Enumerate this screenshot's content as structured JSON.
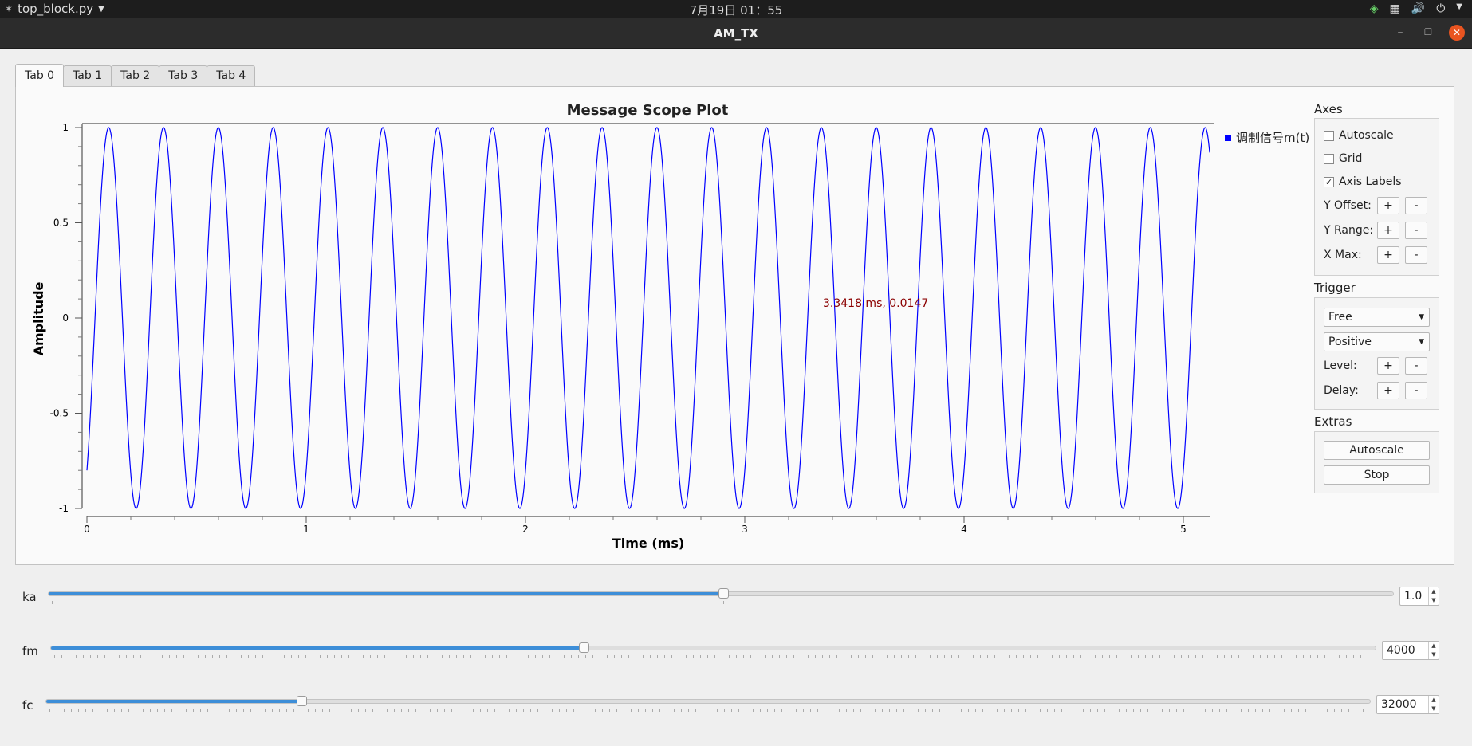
{
  "topbar": {
    "app_name": "top_block.py",
    "clock": "7月19日  01：55"
  },
  "window": {
    "title": "AM_TX"
  },
  "tabs": [
    {
      "label": "Tab 0",
      "active": true
    },
    {
      "label": "Tab 1",
      "active": false
    },
    {
      "label": "Tab 2",
      "active": false
    },
    {
      "label": "Tab 3",
      "active": false
    },
    {
      "label": "Tab 4",
      "active": false
    }
  ],
  "legend": {
    "label": "调制信号m(t)"
  },
  "cursor_readout": "3.3418 ms, 0.0147",
  "controls": {
    "axes": {
      "label": "Axes",
      "autoscale": {
        "label": "Autoscale",
        "checked": false
      },
      "grid": {
        "label": "Grid",
        "checked": false
      },
      "axis_labels": {
        "label": "Axis Labels",
        "checked": true
      },
      "y_offset": "Y Offset:",
      "y_range": "Y Range:",
      "x_max": "X Max:",
      "plus": "+",
      "minus": "-"
    },
    "trigger": {
      "label": "Trigger",
      "mode": "Free",
      "slope": "Positive",
      "level": "Level:",
      "delay": "Delay:"
    },
    "extras": {
      "label": "Extras",
      "autoscale_button": "Autoscale",
      "stop_button": "Stop"
    }
  },
  "sliders": [
    {
      "label": "ka",
      "value": "1.0",
      "fraction": 0.502
    },
    {
      "label": "fm",
      "value": "4000",
      "fraction": 0.402
    },
    {
      "label": "fc",
      "value": "32000",
      "fraction": 0.193
    }
  ],
  "chart_data": {
    "type": "line",
    "title": "Message Scope Plot",
    "xlabel": "Time (ms)",
    "ylabel": "Amplitude",
    "xlim": [
      0,
      5.12
    ],
    "ylim": [
      -1,
      1
    ],
    "x_ticks": [
      "0",
      "1",
      "2",
      "3",
      "4",
      "5"
    ],
    "y_ticks": [
      "1",
      "0.5",
      "0",
      "-0.5",
      "-1"
    ],
    "grid": false,
    "legend": "top-right outside",
    "series": [
      {
        "name": "调制信号m(t)",
        "waveform": "sine",
        "frequency_hz": 4000,
        "amplitude": 1,
        "start_value": -0.8,
        "color": "#0000ff"
      }
    ]
  }
}
